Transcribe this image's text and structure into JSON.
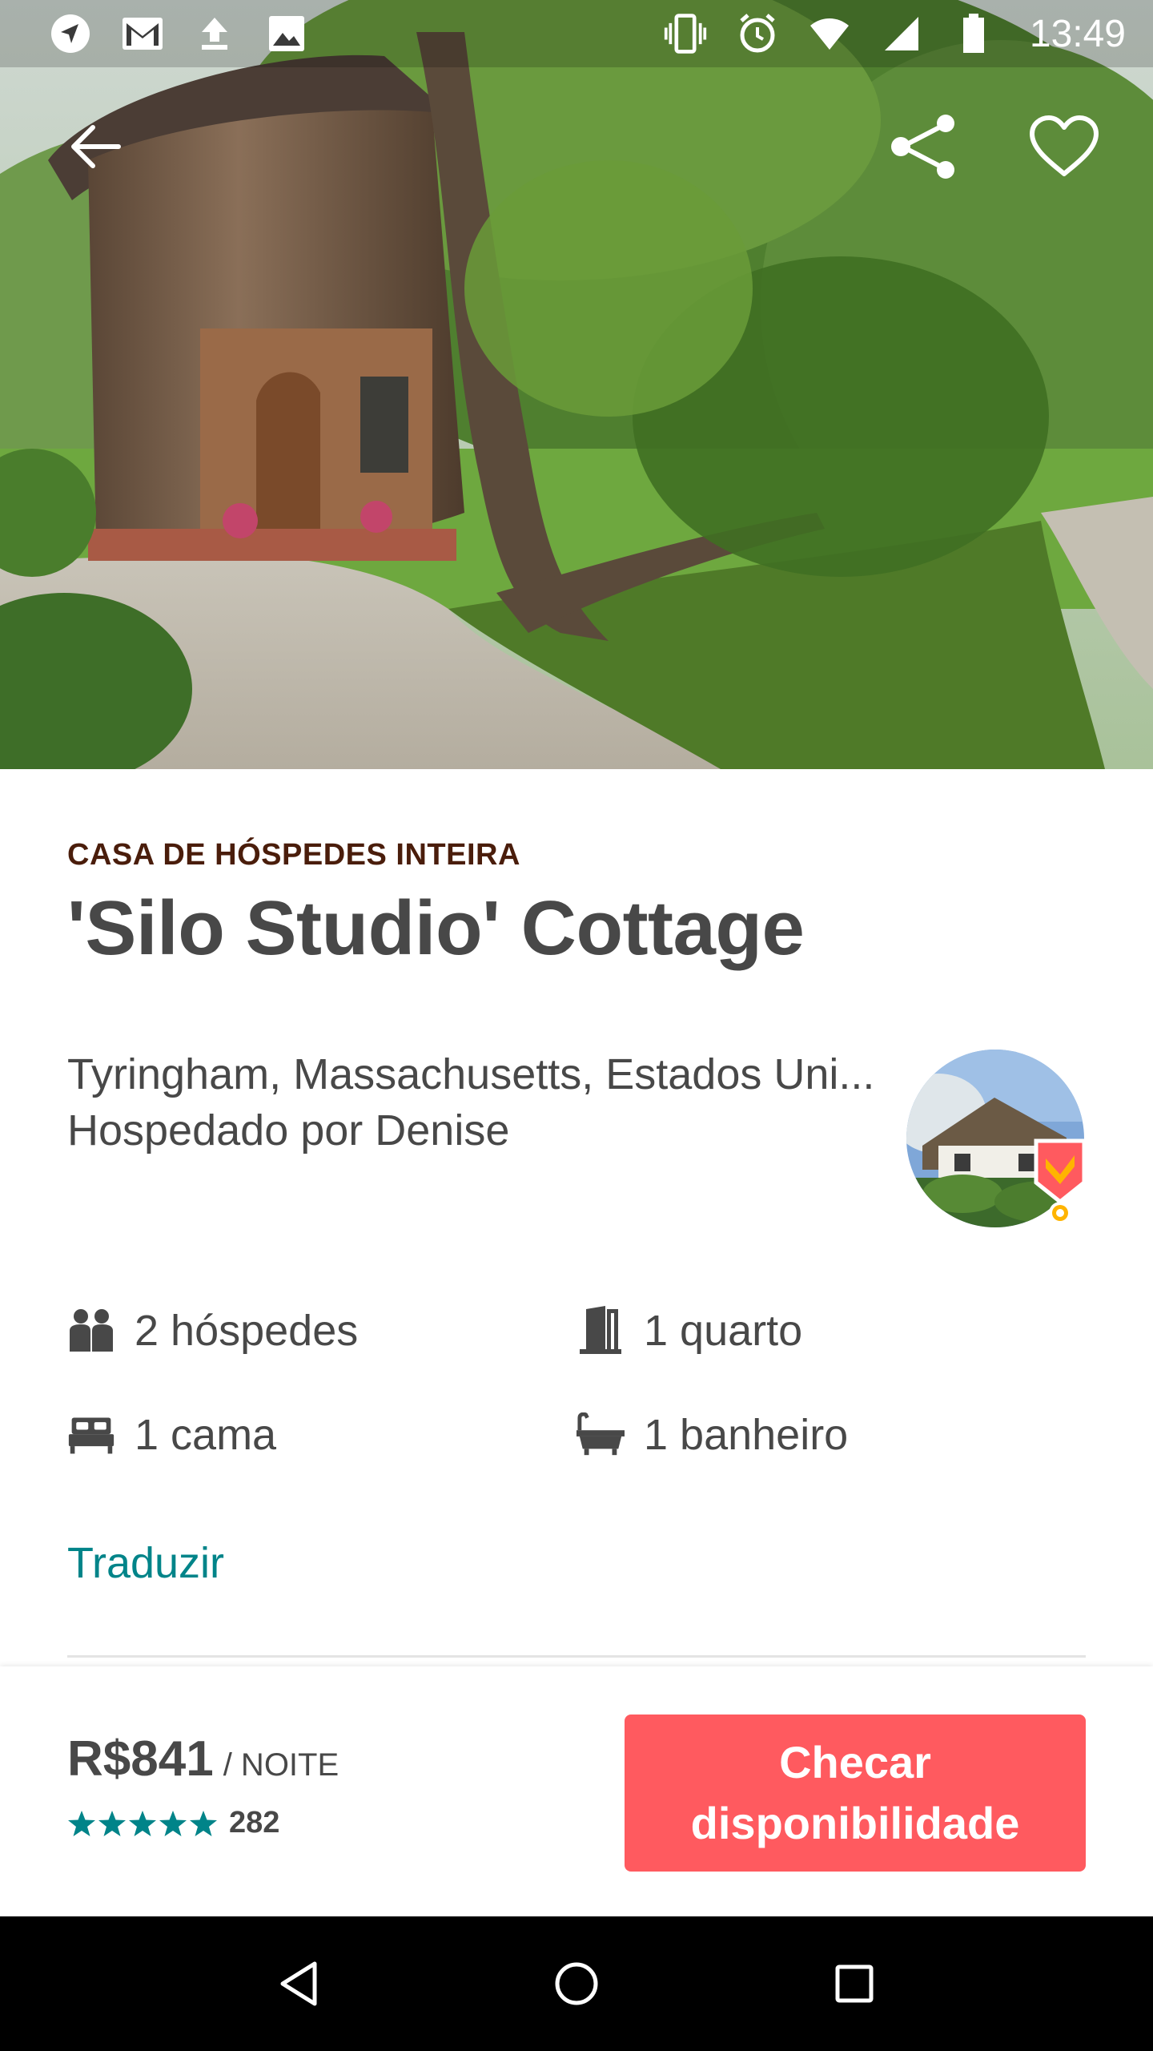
{
  "status_bar": {
    "time": "13:49",
    "left_icons": [
      "navigation-icon",
      "gmail-icon",
      "upload-icon",
      "image-icon"
    ],
    "right_icons": [
      "vibrate-icon",
      "alarm-icon",
      "wifi-icon",
      "signal-icon",
      "battery-icon"
    ]
  },
  "hero": {
    "buttons": [
      "back-arrow-icon",
      "share-icon",
      "heart-icon"
    ]
  },
  "listing": {
    "kicker": "CASA DE HÓSPEDES INTEIRA",
    "title": "'Silo Studio' Cottage",
    "location": "Tyringham, Massachusetts, Estados Uni...",
    "host": "Hospedado por Denise"
  },
  "amenities": {
    "guests": "2 hóspedes",
    "rooms": "1 quarto",
    "beds": "1 cama",
    "baths": "1 banheiro"
  },
  "translate_link": "Traduzir",
  "booking": {
    "price": "R$841",
    "per_night": "/ NOITE",
    "stars": 5,
    "review_count": "282",
    "button_line1": "Checar",
    "button_line2": "disponibilidade"
  },
  "colors": {
    "accent": "#ff5a5f",
    "link": "#008489",
    "text": "#484848",
    "kicker": "#4a1d0b",
    "star": "#008489"
  },
  "nav_bar": {
    "buttons": [
      "back-triangle-icon",
      "home-circle-icon",
      "recents-square-icon"
    ]
  }
}
